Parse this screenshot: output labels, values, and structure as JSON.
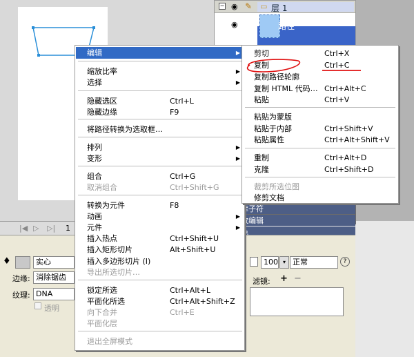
{
  "layers": {
    "layer_name": "层 1",
    "path_name": "路径"
  },
  "panel_bars": [
    "库子符",
    "致编辑",
    "色"
  ],
  "timeline": {
    "frame": "1"
  },
  "props": {
    "fill_style": "实心",
    "edge_label": "边缘:",
    "edge_value": "消除锯齿",
    "texture_label": "纹理:",
    "texture_value": "DNA",
    "transparent_label": "透明",
    "opacity": "100",
    "blend": "正常",
    "filter_label": "滤镜:",
    "add": "+",
    "remove": "−"
  },
  "menu_main": [
    {
      "label": "编辑",
      "sc": "",
      "arrow": true,
      "hl": true,
      "dis": false
    },
    {
      "label": "缩放比率",
      "sc": "",
      "arrow": true,
      "dis": false
    },
    {
      "label": "选择",
      "sc": "",
      "arrow": true,
      "dis": false
    },
    {
      "label": "隐藏选区",
      "sc": "Ctrl+L",
      "dis": false
    },
    {
      "label": "隐藏边缘",
      "sc": "F9",
      "dis": false
    },
    {
      "label": "将路径转换为选取框…",
      "sc": "",
      "dis": false
    },
    {
      "label": "排列",
      "sc": "",
      "arrow": true,
      "dis": false
    },
    {
      "label": "变形",
      "sc": "",
      "arrow": true,
      "dis": false
    },
    {
      "label": "组合",
      "sc": "Ctrl+G",
      "dis": false
    },
    {
      "label": "取消组合",
      "sc": "Ctrl+Shift+G",
      "dis": true
    },
    {
      "label": "转换为元件",
      "sc": "F8",
      "dis": false
    },
    {
      "label": "动画",
      "sc": "",
      "arrow": true,
      "dis": false
    },
    {
      "label": "元件",
      "sc": "",
      "arrow": true,
      "dis": false
    },
    {
      "label": "插入热点",
      "sc": "Ctrl+Shift+U",
      "dis": false
    },
    {
      "label": "插入矩形切片",
      "sc": "Alt+Shift+U",
      "dis": false
    },
    {
      "label": "插入多边形切片 (I)",
      "sc": "",
      "dis": false
    },
    {
      "label": "导出所选切片…",
      "sc": "",
      "dis": true
    },
    {
      "label": "锁定所选",
      "sc": "Ctrl+Alt+L",
      "dis": false
    },
    {
      "label": "平面化所选",
      "sc": "Ctrl+Alt+Shift+Z",
      "dis": false
    },
    {
      "label": "向下合并",
      "sc": "Ctrl+E",
      "dis": true
    },
    {
      "label": "平面化层",
      "sc": "",
      "dis": true
    },
    {
      "label": "退出全屏模式",
      "sc": "",
      "dis": true
    }
  ],
  "menu_sub": [
    {
      "label": "剪切",
      "sc": "Ctrl+X",
      "dis": false
    },
    {
      "label": "复制",
      "sc": "Ctrl+C",
      "dis": false
    },
    {
      "label": "复制路径轮廓",
      "sc": "",
      "dis": false
    },
    {
      "label": "复制 HTML 代码…",
      "sc": "Ctrl+Alt+C",
      "dis": false
    },
    {
      "label": "粘贴",
      "sc": "Ctrl+V",
      "dis": false
    },
    {
      "label": "粘贴为蒙版",
      "sc": "",
      "dis": false
    },
    {
      "label": "粘贴于内部",
      "sc": "Ctrl+Shift+V",
      "dis": false
    },
    {
      "label": "粘贴属性",
      "sc": "Ctrl+Alt+Shift+V",
      "dis": false
    },
    {
      "label": "重制",
      "sc": "Ctrl+Alt+D",
      "dis": false
    },
    {
      "label": "克隆",
      "sc": "Ctrl+Shift+D",
      "dis": false
    },
    {
      "label": "裁剪所选位图",
      "sc": "",
      "dis": true
    },
    {
      "label": "修剪文档",
      "sc": "",
      "dis": false
    }
  ]
}
